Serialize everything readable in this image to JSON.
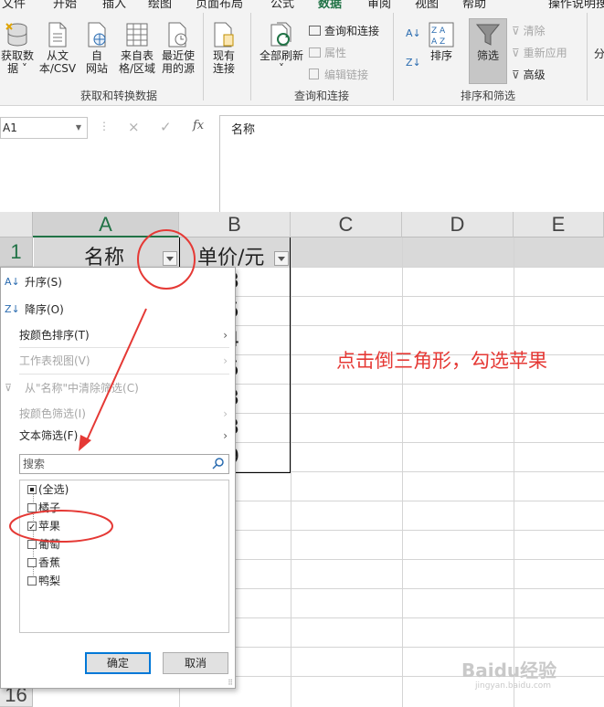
{
  "ribbon": {
    "tabs": [
      "文件",
      "开始",
      "插入",
      "绘图",
      "页面布局",
      "公式",
      "数据",
      "审阅",
      "视图",
      "帮助",
      "操作说明搜"
    ],
    "active_tab": "数据",
    "buttons": {
      "get_data": "获取数\n据 ˅",
      "from_csv": "从文\n本/CSV",
      "from_web": "自\n网站",
      "from_table": "来自表\n格/区域",
      "recent_sources": "最近使\n用的源",
      "existing_conn": "现有\n连接",
      "refresh_all": "全部刷新\n˅",
      "queries_conn": "查询和连接",
      "properties": "属性",
      "edit_links": "编辑链接",
      "sort_az": "A↓Z",
      "sort": "排序",
      "filter": "筛选",
      "clear": "清除",
      "reapply": "重新应用",
      "advanced": "高级",
      "split_cut": "分"
    },
    "groups": {
      "get_transform": "获取和转换数据",
      "queries": "查询和连接",
      "sort_filter": "排序和筛选"
    },
    "colors": {
      "accent": "#217346",
      "annotation": "#e53935",
      "selected_button": "#c6c6c6"
    }
  },
  "formula_bar": {
    "name_box": "A1",
    "content": "名称",
    "cancel_icon": "×",
    "enter_icon": "✓",
    "fx_icon": "fx"
  },
  "grid": {
    "columns": [
      "A",
      "B",
      "C",
      "D",
      "E"
    ],
    "rows": [
      "1",
      "16"
    ],
    "header_a1": "名称",
    "header_b1": "单价/元",
    "b_values": [
      "3",
      "5",
      "4",
      "5",
      "3",
      "3",
      "9"
    ]
  },
  "filter_menu": {
    "sort_asc": "升序(S)",
    "sort_desc": "降序(O)",
    "sort_by_color": "按颜色排序(T)",
    "sheet_view": "工作表视图(V)",
    "clear_filter": "从\"名称\"中清除筛选(C)",
    "filter_by_color": "按颜色筛选(I)",
    "text_filter": "文本筛选(F)",
    "search_placeholder": "搜索",
    "items": [
      {
        "label": "(全选)",
        "state": "partial"
      },
      {
        "label": "橘子",
        "state": "off"
      },
      {
        "label": "苹果",
        "state": "on"
      },
      {
        "label": "葡萄",
        "state": "off"
      },
      {
        "label": "香蕉",
        "state": "off"
      },
      {
        "label": "鸭梨",
        "state": "off"
      }
    ],
    "ok": "确定",
    "cancel": "取消"
  },
  "annotation": {
    "text": "点击倒三角形，勾选苹果"
  },
  "watermark": {
    "text": "Baidu经验",
    "sub": "jingyan.baidu.com"
  }
}
